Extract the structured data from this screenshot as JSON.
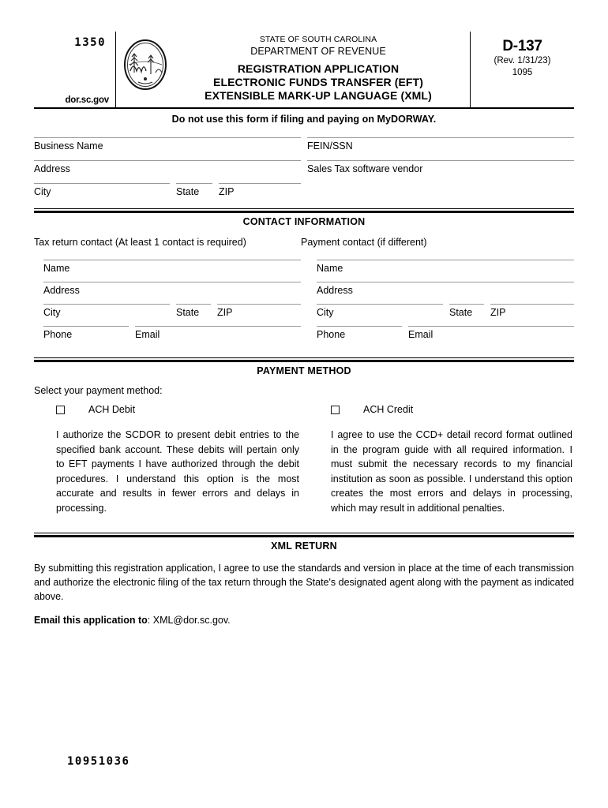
{
  "header": {
    "barcode_top": "1350",
    "website": "dor.sc.gov",
    "seal_alt": "state-seal",
    "state_line": "STATE OF SOUTH CAROLINA",
    "dept_line": "DEPARTMENT OF REVENUE",
    "title_line_1": "REGISTRATION APPLICATION",
    "title_line_2": "ELECTRONIC FUNDS TRANSFER (EFT)",
    "title_line_3": "EXTENSIBLE MARK-UP LANGUAGE (XML)",
    "form_number": "D-137",
    "revision": "(Rev. 1/31/23)",
    "form_code": "1095",
    "notice": "Do not use this form if filing and paying on MyDORWAY."
  },
  "business": {
    "business_name_label": "Business Name",
    "business_name_value": "",
    "fein_ssn_label": "FEIN/SSN",
    "fein_ssn_value": "",
    "address_label": "Address",
    "address_value": "",
    "vendor_label": "Sales Tax software vendor",
    "vendor_value": "",
    "city_label": "City",
    "city_value": "",
    "state_label": "State",
    "state_value": "",
    "zip_label": "ZIP",
    "zip_value": ""
  },
  "contact": {
    "section_title": "CONTACT INFORMATION",
    "tax_heading": "Tax return contact (At least 1 contact is required)",
    "payment_heading": "Payment contact (if different)",
    "fields": {
      "name_label": "Name",
      "address_label": "Address",
      "city_label": "City",
      "state_label": "State",
      "zip_label": "ZIP",
      "phone_label": "Phone",
      "email_label": "Email"
    },
    "tax_values": {
      "name": "",
      "address": "",
      "city": "",
      "state": "",
      "zip": "",
      "phone": "",
      "email": ""
    },
    "payment_values": {
      "name": "",
      "address": "",
      "city": "",
      "state": "",
      "zip": "",
      "phone": "",
      "email": ""
    }
  },
  "payment_method": {
    "section_title": "PAYMENT METHOD",
    "prompt": "Select your payment method:",
    "options": [
      {
        "label": "ACH Debit",
        "checked": false,
        "description": "I authorize the SCDOR to present debit entries to the specified bank account. These debits will pertain only to EFT payments I have authorized through the debit procedures. I understand this option is the most accurate and results in fewer errors and delays in processing."
      },
      {
        "label": "ACH Credit",
        "checked": false,
        "description": "I agree to use the CCD+ detail record format outlined in the program guide with all required information. I must submit the necessary records to my financial institution as soon as possible. I understand this option creates the most errors and delays in processing, which may result in additional penalties."
      }
    ]
  },
  "xml_return": {
    "section_title": "XML RETURN",
    "paragraph": "By submitting this registration application, I agree to use the standards and version in place at the time of each transmission and authorize the electronic filing of the tax return through the State's designated agent along with the payment as indicated above.",
    "email_prefix": "Email this application to",
    "email_separator": ": ",
    "email_address": "XML@dor.sc.gov."
  },
  "footer": {
    "barcode_bottom": "10951036"
  },
  "colors": {
    "ink": "#000000",
    "rule": "#9a9a9a",
    "paper": "#ffffff"
  }
}
